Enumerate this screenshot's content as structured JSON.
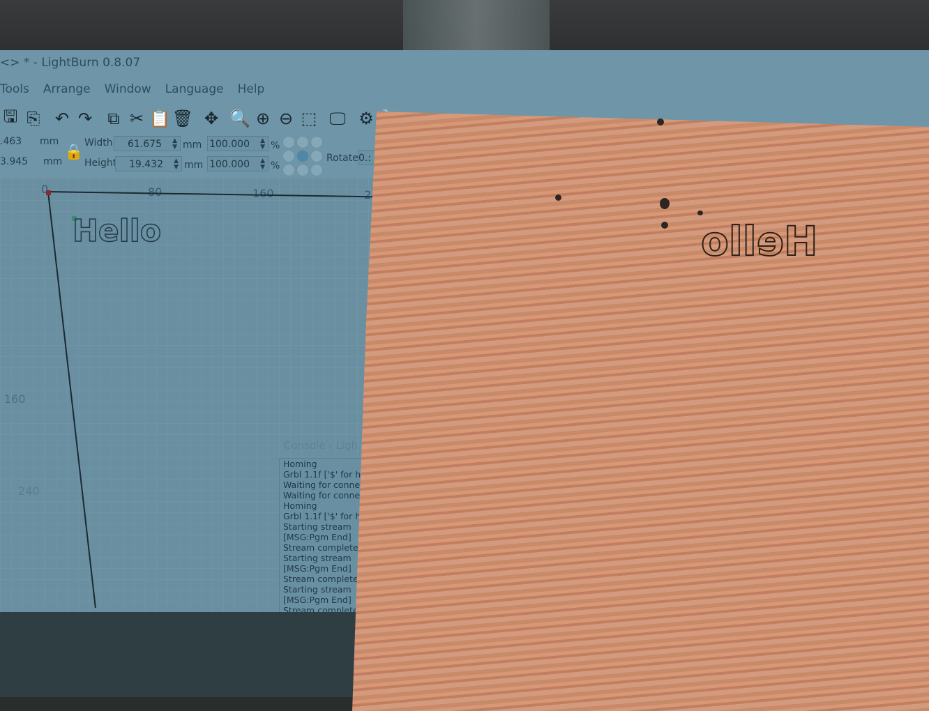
{
  "window": {
    "title": "<> * - LightBurn 0.8.07"
  },
  "menu": [
    "Tools",
    "Arrange",
    "Window",
    "Language",
    "Help"
  ],
  "toolbar": [
    {
      "name": "save-icon",
      "glyph": "🖫"
    },
    {
      "name": "import-icon",
      "glyph": "⎘"
    },
    {
      "name": "undo-icon",
      "glyph": "↶"
    },
    {
      "name": "redo-icon",
      "glyph": "↷"
    },
    {
      "name": "copy-icon",
      "glyph": "⧉"
    },
    {
      "name": "cut-icon",
      "glyph": "✂"
    },
    {
      "name": "paste-icon",
      "glyph": "📋"
    },
    {
      "name": "delete-icon",
      "glyph": "🗑"
    },
    {
      "name": "move-icon",
      "glyph": "✥"
    },
    {
      "name": "zoom-page-icon",
      "glyph": "🔍"
    },
    {
      "name": "zoom-in-icon",
      "glyph": "⊕"
    },
    {
      "name": "zoom-out-icon",
      "glyph": "⊖"
    },
    {
      "name": "zoom-selection-icon",
      "glyph": "⬚"
    },
    {
      "name": "monitor-icon",
      "glyph": "🖵"
    },
    {
      "name": "settings-icon",
      "glyph": "⚙"
    },
    {
      "name": "tools-icon",
      "glyph": "🔧"
    }
  ],
  "props": {
    "x_value": ".463",
    "y_value": "3.945",
    "unit": "mm",
    "width_label": "Width",
    "height_label": "Height",
    "width_value": "61.675",
    "height_value": "19.432",
    "width_pct": "100.000",
    "height_pct": "100.000",
    "pct": "%",
    "rotate_label": "Rotate",
    "rotate_value": "0.:"
  },
  "ruler": {
    "x_ticks": [
      "0",
      "80",
      "160",
      "2"
    ],
    "y_ticks": [
      "160",
      "240"
    ]
  },
  "canvas_text": "Hello",
  "console": {
    "title": "Console - Ligh",
    "lines": [
      "Homing",
      "Grbl 1.1f ['$' for h",
      "Waiting for conne",
      "Waiting for conne",
      "Homing",
      "Grbl 1.1f ['$' for h",
      "Starting stream",
      "[MSG:Pgm End]",
      "Stream complete",
      "Starting stream",
      "[MSG:Pgm End]",
      "Stream complete",
      "Starting stream",
      "[MSG:Pgm End]",
      "Stream complete"
    ]
  },
  "engraved_text": "Hello"
}
